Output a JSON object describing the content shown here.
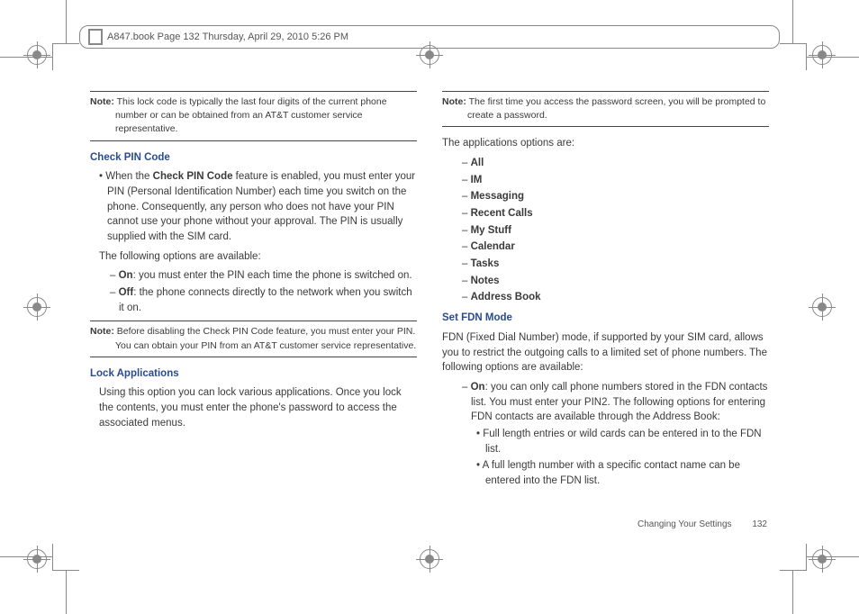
{
  "header": {
    "filename_line": "A847.book  Page 132  Thursday, April 29, 2010  5:26 PM"
  },
  "left_col": {
    "note1": {
      "label": "Note:",
      "text": "This lock code is typically the last four digits of the current phone number or can be obtained from an AT&T customer service representative."
    },
    "sub1": "Check PIN Code",
    "bullet1_a": "When the ",
    "bullet1_bold": "Check PIN Code",
    "bullet1_b": " feature is enabled, you must enter your PIN (Personal Identification Number) each time you switch on the phone. Consequently, any person who does not have your PIN cannot use your phone without your approval. The PIN is usually supplied with the SIM card.",
    "para2": "The following options are available:",
    "opt_on_label": "On",
    "opt_on_text": ": you must enter the PIN each time the phone is switched on.",
    "opt_off_label": "Off",
    "opt_off_text": ": the phone connects directly to the network when you switch it on.",
    "note2": {
      "label": "Note:",
      "text": "Before disabling the Check PIN Code feature, you must enter your PIN. You can obtain your PIN from an AT&T customer service representative."
    },
    "sub2": "Lock Applications",
    "para3": "Using this option you can lock various applications. Once you lock the contents, you must enter the phone's password to access the associated menus."
  },
  "right_col": {
    "note1": {
      "label": "Note:",
      "text": "The first time you access the password screen, you will be prompted to create a password."
    },
    "para1": "The applications options are:",
    "apps": [
      "All",
      "IM",
      "Messaging",
      "Recent Calls",
      "My Stuff",
      "Calendar",
      "Tasks",
      "Notes",
      "Address Book"
    ],
    "sub1": "Set FDN Mode",
    "para2": "FDN (Fixed Dial Number) mode, if supported by your SIM card, allows you to restrict the outgoing calls to a limited set of phone numbers. The following options are available:",
    "fdn_on_label": "On",
    "fdn_on_text": ": you can only call phone numbers stored in the FDN contacts list. You must enter your PIN2. The following options for entering FDN contacts are available through the Address Book:",
    "sub_bullets": [
      "Full length entries or wild cards can be entered in to the FDN list.",
      "A full length number with a specific contact name can be entered into the FDN list."
    ]
  },
  "footer": {
    "section": "Changing Your Settings",
    "page": "132"
  }
}
